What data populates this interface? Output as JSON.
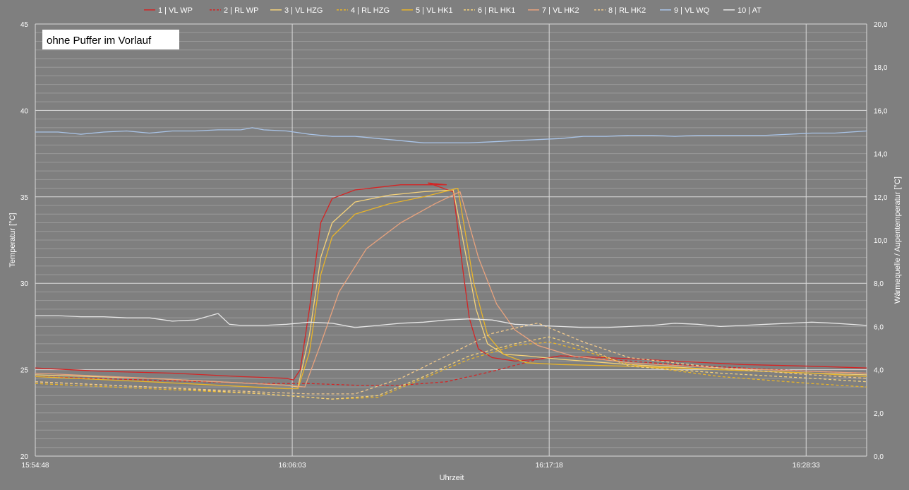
{
  "chart_data": {
    "type": "line",
    "annotation": "ohne Puffer im Vorlauf",
    "xlabel": "Uhrzeit",
    "ylabel_left": "Temperatur [°C]",
    "ylabel_right": "Wärmequelle / Aupentemperatur [°C]",
    "x_ticks": [
      "15:54:48",
      "16:06:03",
      "16:17:18",
      "16:28:33"
    ],
    "xlim_minutes": [
      0,
      36.4
    ],
    "x_tick_minutes": [
      0,
      11.25,
      22.5,
      33.75
    ],
    "ylim_left": [
      20,
      45
    ],
    "yticks_left": [
      20,
      25,
      30,
      35,
      40,
      45
    ],
    "ylim_right": [
      0,
      20
    ],
    "yticks_right": [
      "0,0",
      "2,0",
      "4,0",
      "6,0",
      "8,0",
      "10,0",
      "12,0",
      "14,0",
      "16,0",
      "18,0",
      "20,0"
    ],
    "grid": true,
    "legend_position": "top",
    "colors": {
      "background": "#7f7f7f",
      "grid_major": "#d9d9d9",
      "grid_minor": "#9a9a9a"
    },
    "series": [
      {
        "name": "1 | VL WP",
        "axis": "left",
        "color": "#d42525",
        "dash": false,
        "x": [
          0,
          3,
          6,
          9,
          11,
          11.3,
          11.6,
          12,
          12.5,
          13,
          14,
          16,
          18,
          17.2,
          18.3,
          18.7,
          19,
          19.4,
          20,
          21,
          22,
          23,
          25,
          28,
          31,
          34,
          36.4
        ],
        "y": [
          25.1,
          24.9,
          24.8,
          24.6,
          24.5,
          24.4,
          25,
          28.5,
          33.5,
          34.9,
          35.4,
          35.7,
          35.7,
          35.8,
          35.3,
          31,
          28,
          26.2,
          25.7,
          25.5,
          25.6,
          25.8,
          25.7,
          25.5,
          25.3,
          25.2,
          25.1
        ]
      },
      {
        "name": "2 | RL WP",
        "axis": "left",
        "color": "#d42525",
        "dash": true,
        "x": [
          0,
          5,
          10,
          12,
          14,
          16,
          18,
          20,
          22,
          23,
          25,
          28,
          31,
          34,
          36.4
        ],
        "y": [
          24.6,
          24.4,
          24.2,
          24.2,
          24.1,
          24.1,
          24.3,
          24.9,
          25.6,
          25.8,
          25.6,
          25.3,
          25.1,
          24.9,
          24.8
        ]
      },
      {
        "name": "3 | VL HZG",
        "axis": "left",
        "color": "#f5d27a",
        "dash": false,
        "x": [
          0,
          5,
          11,
          11.5,
          12,
          12.5,
          13,
          14,
          15.5,
          17,
          18.3,
          18.8,
          19.3,
          19.8,
          20.5,
          21.5,
          23,
          26,
          30,
          34,
          36.4
        ],
        "y": [
          24.7,
          24.5,
          24.1,
          24.0,
          27,
          31.5,
          33.5,
          34.7,
          35.1,
          35.3,
          35.4,
          32,
          28.5,
          26.5,
          25.9,
          25.8,
          25.6,
          25.3,
          25.0,
          24.8,
          24.7
        ]
      },
      {
        "name": "4 | RL HZG",
        "axis": "left",
        "color": "#e8b429",
        "dash": true,
        "x": [
          0,
          5,
          10,
          13,
          15,
          17,
          19,
          21,
          22.5,
          24,
          26,
          30,
          34,
          36.4
        ],
        "y": [
          24.2,
          23.9,
          23.6,
          23.3,
          23.4,
          24.5,
          25.6,
          26.4,
          26.6,
          26.1,
          25.3,
          24.6,
          24.2,
          24.0
        ]
      },
      {
        "name": "5 | VL HK1",
        "axis": "left",
        "color": "#e8b429",
        "dash": false,
        "x": [
          0,
          5,
          11,
          11.5,
          12,
          12.5,
          13,
          14,
          15.5,
          17,
          18.5,
          19.2,
          19.8,
          20.5,
          21.5,
          23,
          26,
          30,
          34,
          36.4
        ],
        "y": [
          24.6,
          24.3,
          23.9,
          23.9,
          26,
          30.5,
          32.7,
          34.0,
          34.6,
          35.0,
          35.5,
          30,
          27,
          25.9,
          25.4,
          25.3,
          25.2,
          25.0,
          24.8,
          24.6
        ]
      },
      {
        "name": "6 | RL HK1",
        "axis": "left",
        "color": "#f5d27a",
        "dash": true,
        "x": [
          0,
          5,
          10,
          13,
          15,
          17,
          19,
          21,
          22.5,
          24,
          26,
          30,
          34,
          36.4
        ],
        "y": [
          24.3,
          24.0,
          23.6,
          23.3,
          23.5,
          24.6,
          25.8,
          26.5,
          26.9,
          26.3,
          25.2,
          24.8,
          24.5,
          24.3
        ]
      },
      {
        "name": "7 | VL HK2",
        "axis": "left",
        "color": "#e8a27d",
        "dash": false,
        "x": [
          0,
          5,
          11,
          11.8,
          12.5,
          13.3,
          14.5,
          16,
          17.5,
          18.6,
          19.4,
          20.2,
          21,
          22,
          23.5,
          26,
          30,
          34,
          36.4
        ],
        "y": [
          24.8,
          24.5,
          24.1,
          24.0,
          26.5,
          29.5,
          32.0,
          33.5,
          34.6,
          35.3,
          31.5,
          28.8,
          27.3,
          26.4,
          25.8,
          25.4,
          25.1,
          24.9,
          24.8
        ]
      },
      {
        "name": "8 | RL HK2",
        "axis": "left",
        "color": "#f2c98a",
        "dash": true,
        "x": [
          0,
          5,
          10,
          12,
          14,
          16,
          18,
          20,
          22,
          24,
          26,
          30,
          34,
          36.4
        ],
        "y": [
          24.3,
          24.0,
          23.7,
          23.6,
          23.6,
          24.5,
          25.8,
          27.1,
          27.7,
          26.6,
          25.7,
          25.1,
          24.7,
          24.5
        ]
      },
      {
        "name": "9 | VL WQ",
        "axis": "right",
        "color": "#a9c4e8",
        "dash": false,
        "x": [
          0,
          1,
          2,
          3,
          4,
          5,
          6,
          7,
          8,
          9,
          9.5,
          10,
          11,
          12,
          13,
          14,
          15,
          16,
          17,
          18,
          19,
          20,
          21,
          22,
          23,
          24,
          25,
          26,
          27,
          28,
          29,
          30,
          31,
          32,
          33,
          34,
          35,
          36.4
        ],
        "y": [
          15.0,
          15.0,
          14.9,
          15.0,
          15.05,
          14.95,
          15.05,
          15.05,
          15.1,
          15.1,
          15.2,
          15.1,
          15.05,
          14.9,
          14.8,
          14.8,
          14.7,
          14.6,
          14.5,
          14.5,
          14.5,
          14.55,
          14.6,
          14.65,
          14.7,
          14.8,
          14.8,
          14.85,
          14.85,
          14.8,
          14.85,
          14.85,
          14.85,
          14.85,
          14.9,
          14.95,
          14.95,
          15.05
        ]
      },
      {
        "name": "10 | AT",
        "axis": "right",
        "color": "#e6e6e6",
        "dash": false,
        "x": [
          0,
          1,
          2,
          3,
          4,
          5,
          6,
          7,
          8,
          8.5,
          9,
          10,
          11,
          12,
          13,
          14,
          15,
          16,
          17,
          18,
          19,
          20,
          21,
          22,
          23,
          24,
          25,
          26,
          27,
          28,
          29,
          30,
          31,
          32,
          33,
          34,
          35,
          36.4
        ],
        "y": [
          6.5,
          6.5,
          6.45,
          6.45,
          6.4,
          6.4,
          6.25,
          6.3,
          6.6,
          6.1,
          6.05,
          6.05,
          6.1,
          6.2,
          6.15,
          5.95,
          6.05,
          6.15,
          6.2,
          6.3,
          6.35,
          6.3,
          6.1,
          6.05,
          6.0,
          5.95,
          5.95,
          6.0,
          6.05,
          6.15,
          6.1,
          6.0,
          6.05,
          6.1,
          6.15,
          6.2,
          6.15,
          6.05
        ]
      }
    ]
  }
}
